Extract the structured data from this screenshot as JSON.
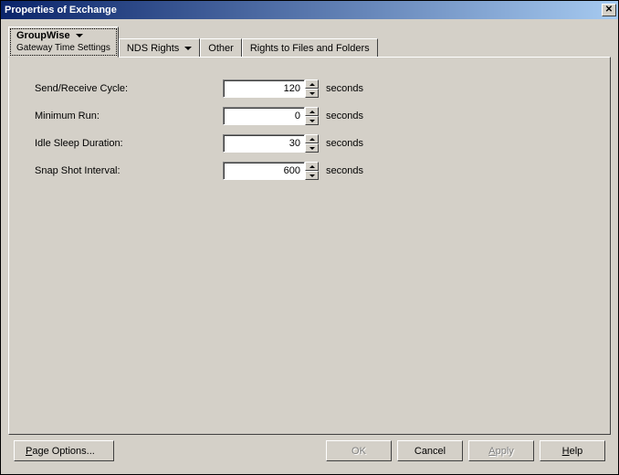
{
  "window": {
    "title": "Properties of Exchange"
  },
  "tabs": {
    "active": {
      "label": "GroupWise",
      "sub": "Gateway Time Settings"
    },
    "nds": "NDS Rights",
    "other": "Other",
    "rights": "Rights to Files and Folders"
  },
  "fields": {
    "sendReceive": {
      "label": "Send/Receive Cycle:",
      "value": "120",
      "unit": "seconds"
    },
    "minRun": {
      "label": "Minimum Run:",
      "value": "0",
      "unit": "seconds"
    },
    "idleSleep": {
      "label": "Idle Sleep Duration:",
      "value": "30",
      "unit": "seconds"
    },
    "snapShot": {
      "label": "Snap Shot Interval:",
      "value": "600",
      "unit": "seconds"
    }
  },
  "buttons": {
    "pageOptions": "Page Options...",
    "ok": "OK",
    "cancel": "Cancel",
    "apply": "Apply",
    "help": "Help"
  }
}
